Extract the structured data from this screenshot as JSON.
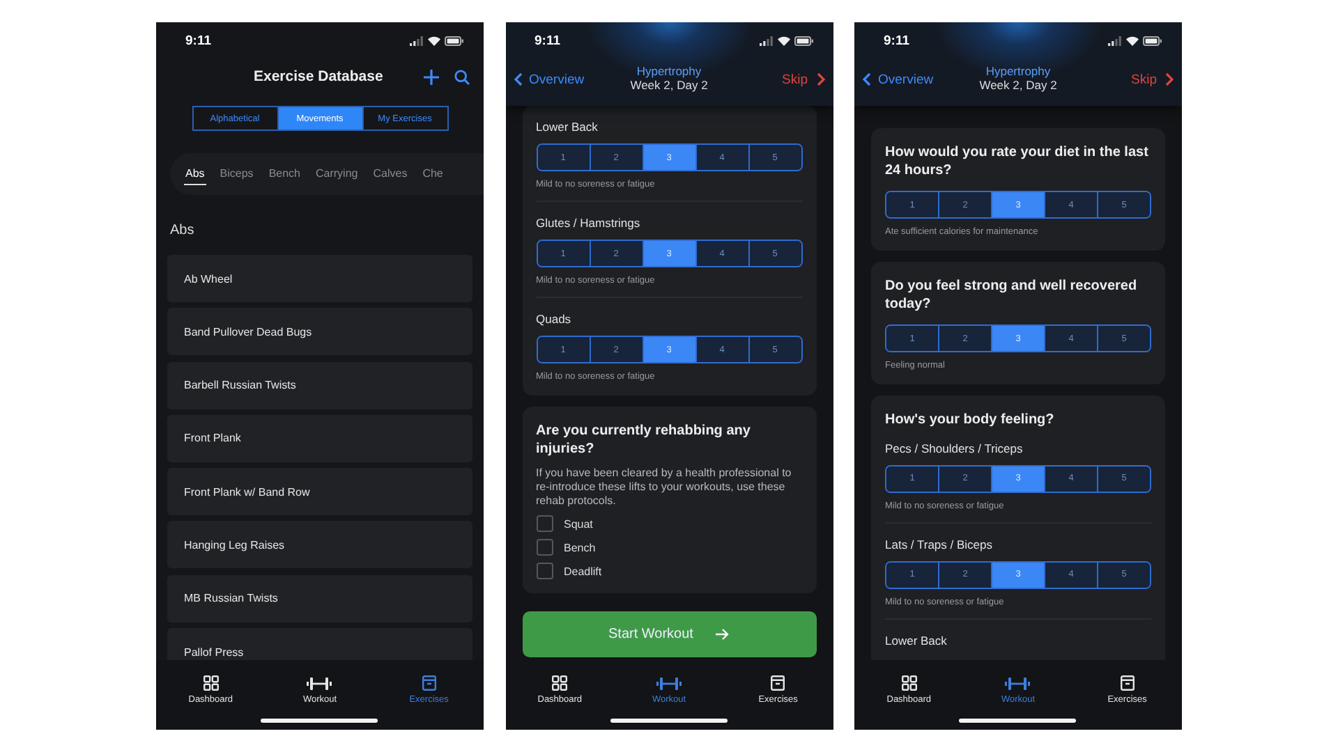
{
  "screens": [
    {
      "kind": "database",
      "time": "9:11",
      "title": "Exercise Database",
      "segments": [
        {
          "label": "Alphabetical",
          "selected": false
        },
        {
          "label": "Movements",
          "selected": true
        },
        {
          "label": "My Exercises",
          "selected": false
        }
      ],
      "chips": [
        {
          "label": "Abs",
          "selected": true
        },
        {
          "label": "Biceps",
          "selected": false
        },
        {
          "label": "Bench",
          "selected": false
        },
        {
          "label": "Carrying",
          "selected": false
        },
        {
          "label": "Calves",
          "selected": false
        },
        {
          "label": "Che",
          "selected": false
        }
      ],
      "section_title": "Abs",
      "exercises": [
        "Ab Wheel",
        "Band Pullover Dead Bugs",
        "Barbell Russian Twists",
        "Front Plank",
        "Front Plank w/ Band Row",
        "Hanging Leg Raises",
        "MB Russian Twists",
        "Pallof Press"
      ],
      "tabbar": [
        {
          "label": "Dashboard",
          "selected": false
        },
        {
          "label": "Workout",
          "selected": false
        },
        {
          "label": "Exercises",
          "selected": true
        }
      ]
    },
    {
      "kind": "checkin",
      "time": "9:11",
      "back": "Overview",
      "title": "Hypertrophy",
      "subtitle": "Week 2, Day 2",
      "skip": "Skip",
      "cards": [
        {
          "questions": [
            {
              "label": "Lower Back",
              "caption": "Mild to no soreness or fatigue",
              "options": [
                {
                  "label": "1",
                  "selected": false
                },
                {
                  "label": "2",
                  "selected": false
                },
                {
                  "label": "3",
                  "selected": true
                },
                {
                  "label": "4",
                  "selected": false
                },
                {
                  "label": "5",
                  "selected": false
                }
              ]
            },
            {
              "label": "Glutes / Hamstrings",
              "caption": "Mild to no soreness or fatigue",
              "options": [
                {
                  "label": "1",
                  "selected": false
                },
                {
                  "label": "2",
                  "selected": false
                },
                {
                  "label": "3",
                  "selected": true
                },
                {
                  "label": "4",
                  "selected": false
                },
                {
                  "label": "5",
                  "selected": false
                }
              ]
            },
            {
              "label": "Quads",
              "caption": "Mild to no soreness or fatigue",
              "options": [
                {
                  "label": "1",
                  "selected": false
                },
                {
                  "label": "2",
                  "selected": false
                },
                {
                  "label": "3",
                  "selected": true
                },
                {
                  "label": "4",
                  "selected": false
                },
                {
                  "label": "5",
                  "selected": false
                }
              ]
            }
          ]
        },
        {
          "title": "Are you currently rehabbing any injuries?",
          "description": "If you have been cleared by a health professional to re-introduce these lifts to your workouts, use these rehab protocols.",
          "checkboxes": [
            {
              "label": "Squat",
              "checked": false
            },
            {
              "label": "Bench",
              "checked": false
            },
            {
              "label": "Deadlift",
              "checked": false
            }
          ]
        }
      ],
      "start_button": "Start Workout",
      "tabbar": [
        {
          "label": "Dashboard",
          "selected": false
        },
        {
          "label": "Workout",
          "selected": true
        },
        {
          "label": "Exercises",
          "selected": false
        }
      ]
    },
    {
      "kind": "checkin",
      "time": "9:11",
      "back": "Overview",
      "title": "Hypertrophy",
      "subtitle": "Week 2, Day 2",
      "skip": "Skip",
      "cards": [
        {
          "title": "How would you rate your diet in the last 24 hours?",
          "questions": [
            {
              "caption": "Ate sufficient calories for maintenance",
              "options": [
                {
                  "label": "1",
                  "selected": false
                },
                {
                  "label": "2",
                  "selected": false
                },
                {
                  "label": "3",
                  "selected": true
                },
                {
                  "label": "4",
                  "selected": false
                },
                {
                  "label": "5",
                  "selected": false
                }
              ]
            }
          ]
        },
        {
          "title": "Do you feel strong and well recovered today?",
          "questions": [
            {
              "caption": "Feeling normal",
              "options": [
                {
                  "label": "1",
                  "selected": false
                },
                {
                  "label": "2",
                  "selected": false
                },
                {
                  "label": "3",
                  "selected": true
                },
                {
                  "label": "4",
                  "selected": false
                },
                {
                  "label": "5",
                  "selected": false
                }
              ]
            }
          ]
        },
        {
          "title": "How's your body feeling?",
          "questions": [
            {
              "label": "Pecs / Shoulders / Triceps",
              "caption": "Mild to no soreness or fatigue",
              "options": [
                {
                  "label": "1",
                  "selected": false
                },
                {
                  "label": "2",
                  "selected": false
                },
                {
                  "label": "3",
                  "selected": true
                },
                {
                  "label": "4",
                  "selected": false
                },
                {
                  "label": "5",
                  "selected": false
                }
              ]
            },
            {
              "label": "Lats / Traps / Biceps",
              "caption": "Mild to no soreness or fatigue",
              "options": [
                {
                  "label": "1",
                  "selected": false
                },
                {
                  "label": "2",
                  "selected": false
                },
                {
                  "label": "3",
                  "selected": true
                },
                {
                  "label": "4",
                  "selected": false
                },
                {
                  "label": "5",
                  "selected": false
                }
              ]
            },
            {
              "label": "Lower Back"
            }
          ]
        }
      ],
      "tabbar": [
        {
          "label": "Dashboard",
          "selected": false
        },
        {
          "label": "Workout",
          "selected": true
        },
        {
          "label": "Exercises",
          "selected": false
        }
      ]
    }
  ]
}
